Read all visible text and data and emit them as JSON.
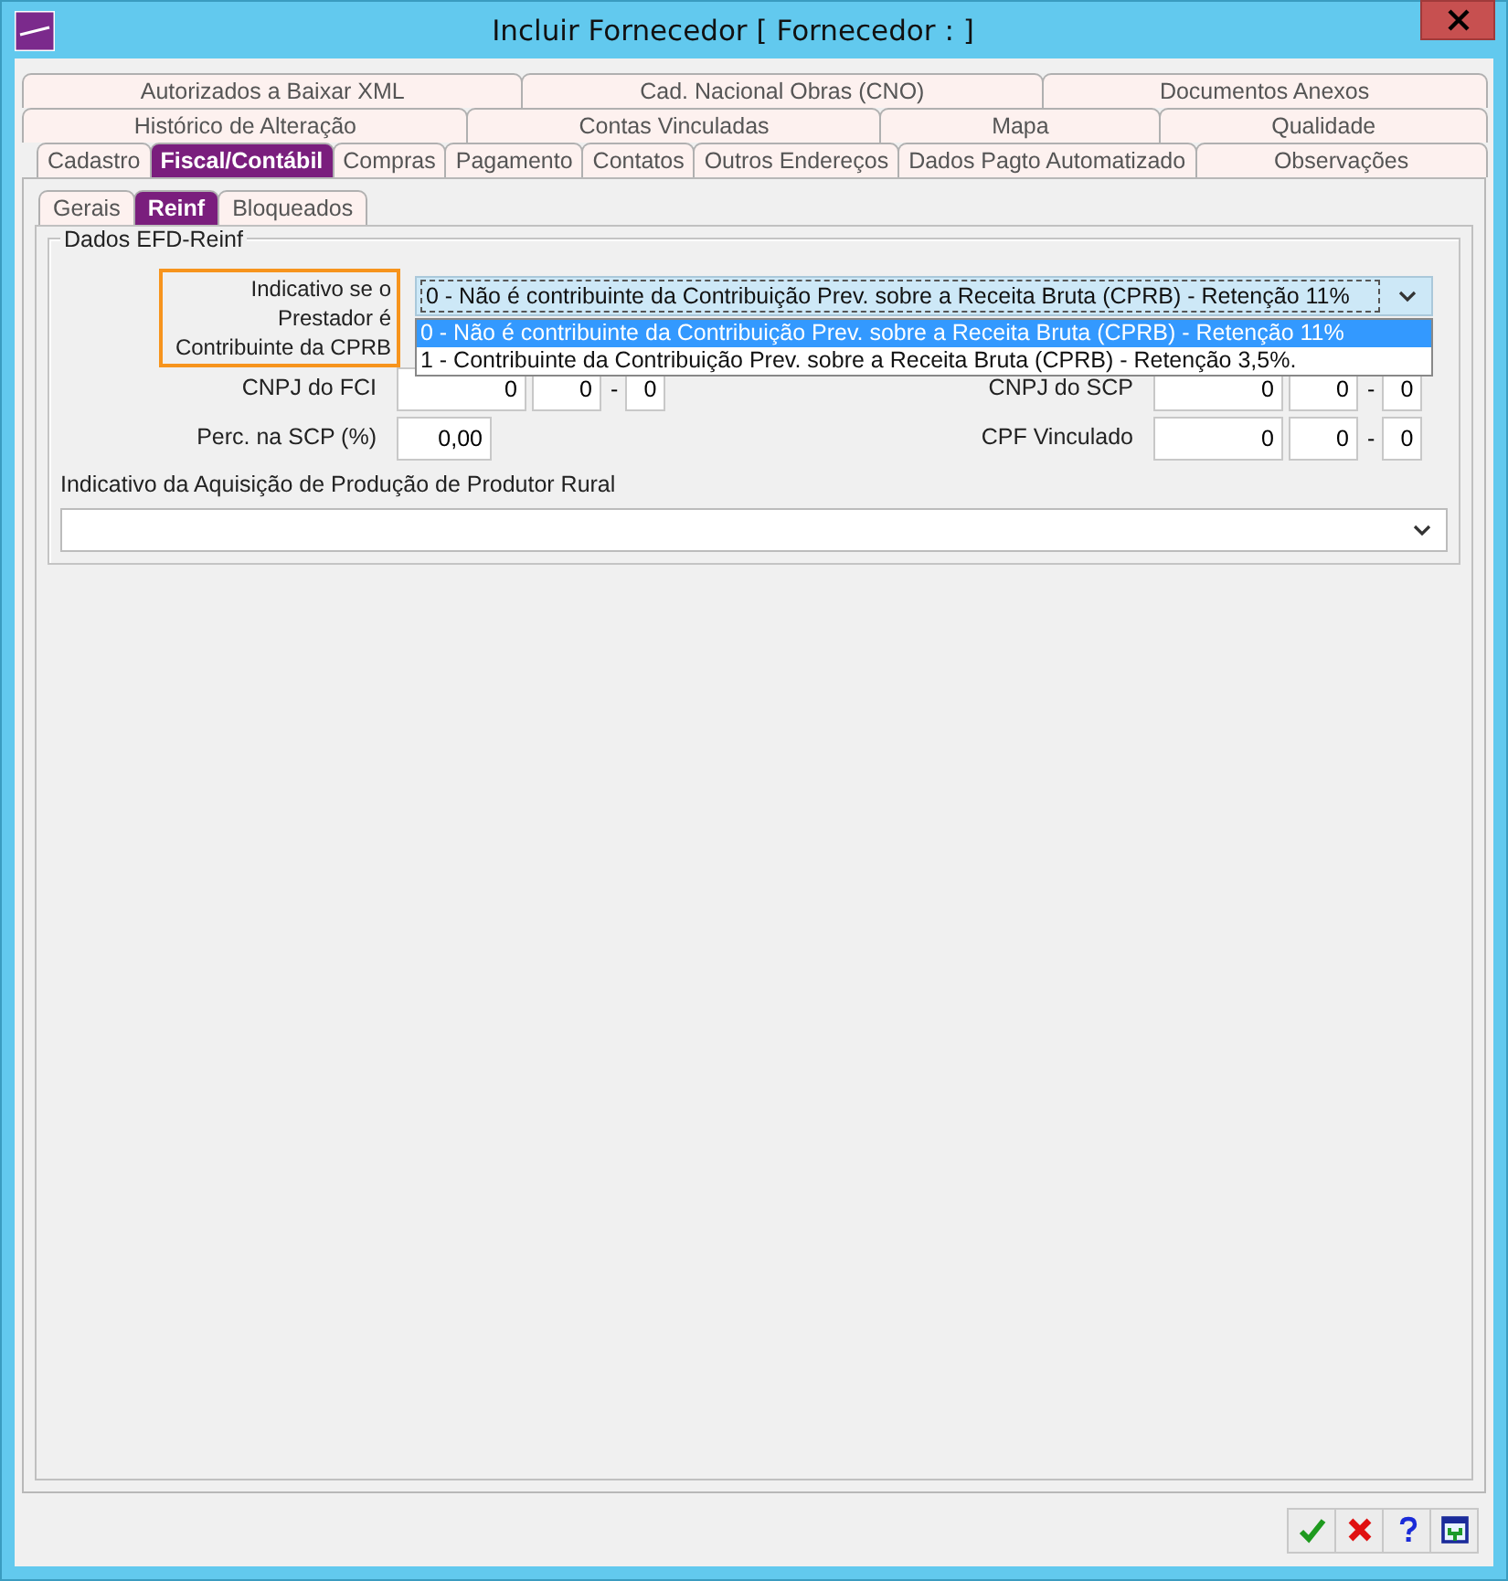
{
  "window": {
    "title": "Incluir Fornecedor [ Fornecedor : ]"
  },
  "tab_rows": [
    [
      {
        "label": "Autorizados a Baixar XML",
        "selected": false
      },
      {
        "label": "Cad. Nacional Obras (CNO)",
        "selected": false
      },
      {
        "label": "Documentos Anexos",
        "selected": false
      }
    ],
    [
      {
        "label": "Histórico de Alteração",
        "selected": false
      },
      {
        "label": "Contas Vinculadas",
        "selected": false
      },
      {
        "label": "Mapa",
        "selected": false
      },
      {
        "label": "Qualidade",
        "selected": false
      }
    ],
    [
      {
        "label": "Cadastro",
        "selected": false
      },
      {
        "label": "Fiscal/Contábil",
        "selected": true
      },
      {
        "label": "Compras",
        "selected": false
      },
      {
        "label": "Pagamento",
        "selected": false
      },
      {
        "label": "Contatos",
        "selected": false
      },
      {
        "label": "Outros Endereços",
        "selected": false
      },
      {
        "label": "Dados Pagto Automatizado",
        "selected": false
      },
      {
        "label": "Observações",
        "selected": false
      }
    ]
  ],
  "subtabs": [
    {
      "label": "Gerais",
      "selected": false
    },
    {
      "label": "Reinf",
      "selected": true
    },
    {
      "label": "Bloqueados",
      "selected": false
    }
  ],
  "group": {
    "title": "Dados EFD-Reinf",
    "cprb": {
      "label": "Indicativo se o Prestador é Contribuinte da CPRB",
      "highlighted": true,
      "value": "0 - Não é contribuinte da Contribuição Prev. sobre a Receita Bruta (CPRB) - Retenção 11%",
      "expanded": true,
      "options": [
        {
          "label": "0 - Não é contribuinte da Contribuição Prev. sobre a Receita Bruta (CPRB) - Retenção 11%",
          "selected": true
        },
        {
          "label": "1 - Contribuinte da Contribuição Prev. sobre a Receita Bruta (CPRB) - Retenção 3,5%.",
          "selected": false
        }
      ]
    },
    "rows": [
      [
        {
          "label": "CNPJ do FCI",
          "parts": [
            "0",
            "0",
            "0"
          ],
          "separator": "-"
        },
        {
          "label": "CNPJ do SCP",
          "parts": [
            "0",
            "0",
            "0"
          ],
          "separator": "-"
        }
      ],
      [
        {
          "label": "Perc. na SCP (%)",
          "parts": [
            "0,00"
          ]
        },
        {
          "label": "CPF Vinculado",
          "parts": [
            "0",
            "0",
            "0"
          ],
          "separator": "-"
        }
      ]
    ],
    "rural": {
      "label": "Indicativo da Aquisição de Produção de Produtor Rural"
    }
  },
  "footer_buttons": [
    {
      "kind": "confirm"
    },
    {
      "kind": "cancel"
    },
    {
      "kind": "help"
    },
    {
      "kind": "exit"
    }
  ]
}
